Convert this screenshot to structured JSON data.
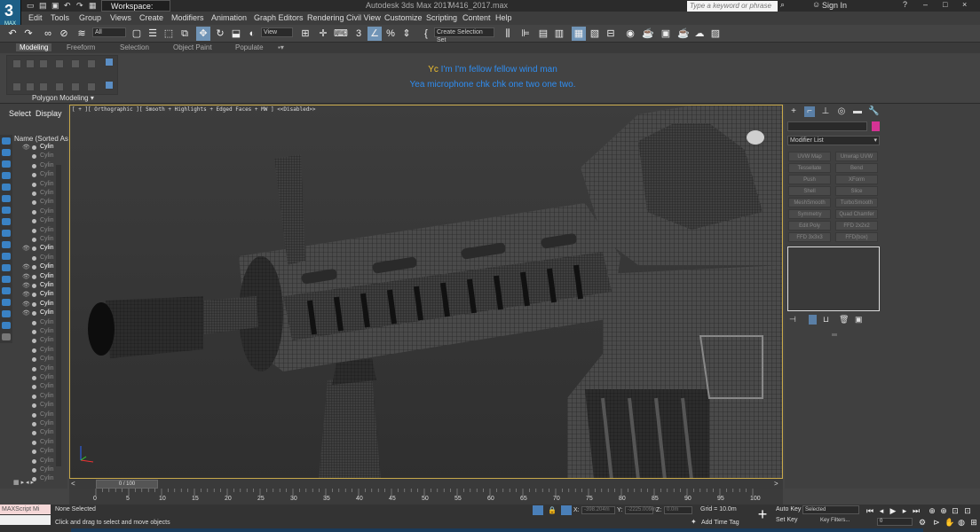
{
  "window": {
    "app_title": "Autodesk 3ds Max 2017",
    "file_name": "M416_2017.max",
    "logo_text": "3",
    "logo_sub": "MAX",
    "workspace_label": "Workspace: Default",
    "search_placeholder": "Type a keyword or phrase",
    "sign_in": "Sign In"
  },
  "menu": [
    "Edit",
    "Tools",
    "Group",
    "Views",
    "Create",
    "Modifiers",
    "Animation",
    "Graph Editors",
    "Rendering",
    "Civil View",
    "Customize",
    "Scripting",
    "Content",
    "Help"
  ],
  "toolbar": {
    "filter_dropdown": "All",
    "view_dropdown": "View",
    "selection_set": "Create Selection Set"
  },
  "ribbon": {
    "tabs": [
      "Modeling",
      "Freeform",
      "Selection",
      "Object Paint",
      "Populate"
    ],
    "active_tab": "Modeling",
    "panel_label": "Polygon Modeling"
  },
  "subtitles": {
    "line1_prefix": "Yc",
    "line1": "I'm I'm fellow fellow wind man",
    "line2": "Yea microphone chk chk one two one two."
  },
  "scene_explorer": {
    "tabs": [
      "Select",
      "Display"
    ],
    "header": "Name (Sorted As",
    "rows": [
      {
        "name": "Cylin",
        "on": true
      },
      {
        "name": "Cylin",
        "on": false
      },
      {
        "name": "Cylin",
        "on": false
      },
      {
        "name": "Cylin",
        "on": false
      },
      {
        "name": "Cylin",
        "on": false
      },
      {
        "name": "Cylin",
        "on": false
      },
      {
        "name": "Cylin",
        "on": false
      },
      {
        "name": "Cylin",
        "on": false
      },
      {
        "name": "Cylin",
        "on": false
      },
      {
        "name": "Cylin",
        "on": false
      },
      {
        "name": "Cylin",
        "on": false
      },
      {
        "name": "Cylin",
        "on": true
      },
      {
        "name": "Cylin",
        "on": false
      },
      {
        "name": "Cylin",
        "on": true
      },
      {
        "name": "Cylin",
        "on": true
      },
      {
        "name": "Cylin",
        "on": true
      },
      {
        "name": "Cylin",
        "on": true
      },
      {
        "name": "Cylin",
        "on": true
      },
      {
        "name": "Cylin",
        "on": true
      },
      {
        "name": "Cylin",
        "on": false
      },
      {
        "name": "Cylin",
        "on": false
      },
      {
        "name": "Cylin",
        "on": false
      },
      {
        "name": "Cylin",
        "on": false
      },
      {
        "name": "Cylin",
        "on": false
      },
      {
        "name": "Cylin",
        "on": false
      },
      {
        "name": "Cylin",
        "on": false
      },
      {
        "name": "Cylin",
        "on": false
      },
      {
        "name": "Cylin",
        "on": false
      },
      {
        "name": "Cylin",
        "on": false
      },
      {
        "name": "Cylin",
        "on": false
      },
      {
        "name": "Cylin",
        "on": false
      },
      {
        "name": "Cylin",
        "on": false
      },
      {
        "name": "Cylin",
        "on": false
      },
      {
        "name": "Cylin",
        "on": false
      },
      {
        "name": "Cylin",
        "on": false
      },
      {
        "name": "Cylin",
        "on": false
      },
      {
        "name": "Cylin",
        "on": false
      }
    ]
  },
  "viewport": {
    "label": "[ + ][ Orthographic ][ Smooth + Highlights + Edged Faces + MW ] <<Disabled>>"
  },
  "command_panel": {
    "modifier_list": "Modifier List",
    "modifiers": [
      "UVW Map",
      "Unwrap UVW",
      "Tessellate",
      "Bend",
      "Push",
      "XForm",
      "Shell",
      "Slice",
      "MeshSmooth",
      "TurboSmooth",
      "Symmetry",
      "Quad Chamfer",
      "Edit Poly",
      "FFD 2x2x2",
      "FFD 3x3x3",
      "FFD(box)"
    ],
    "swatch_color": "#d43394"
  },
  "timeline": {
    "slider": "0 / 100",
    "ticks": [
      "0",
      "5",
      "10",
      "15",
      "20",
      "25",
      "30",
      "35",
      "40",
      "45",
      "50",
      "55",
      "60",
      "65",
      "70",
      "75",
      "80",
      "85",
      "90",
      "95",
      "100"
    ]
  },
  "status": {
    "maxscript": "MAXScript Mi",
    "selection": "None Selected",
    "hint": "Click and drag to select and move objects",
    "x_label": "X:",
    "x_value": "-398.204m",
    "y_label": "Y:",
    "y_value": "-2225.009m",
    "z_label": "Z:",
    "z_value": "0.0m",
    "grid": "Grid = 10.0m",
    "add_time_tag": "Add Time Tag",
    "auto_key": "Auto Key",
    "set_key": "Set Key",
    "selected": "Selected",
    "key_filters": "Key Filters...",
    "frame": "0"
  }
}
